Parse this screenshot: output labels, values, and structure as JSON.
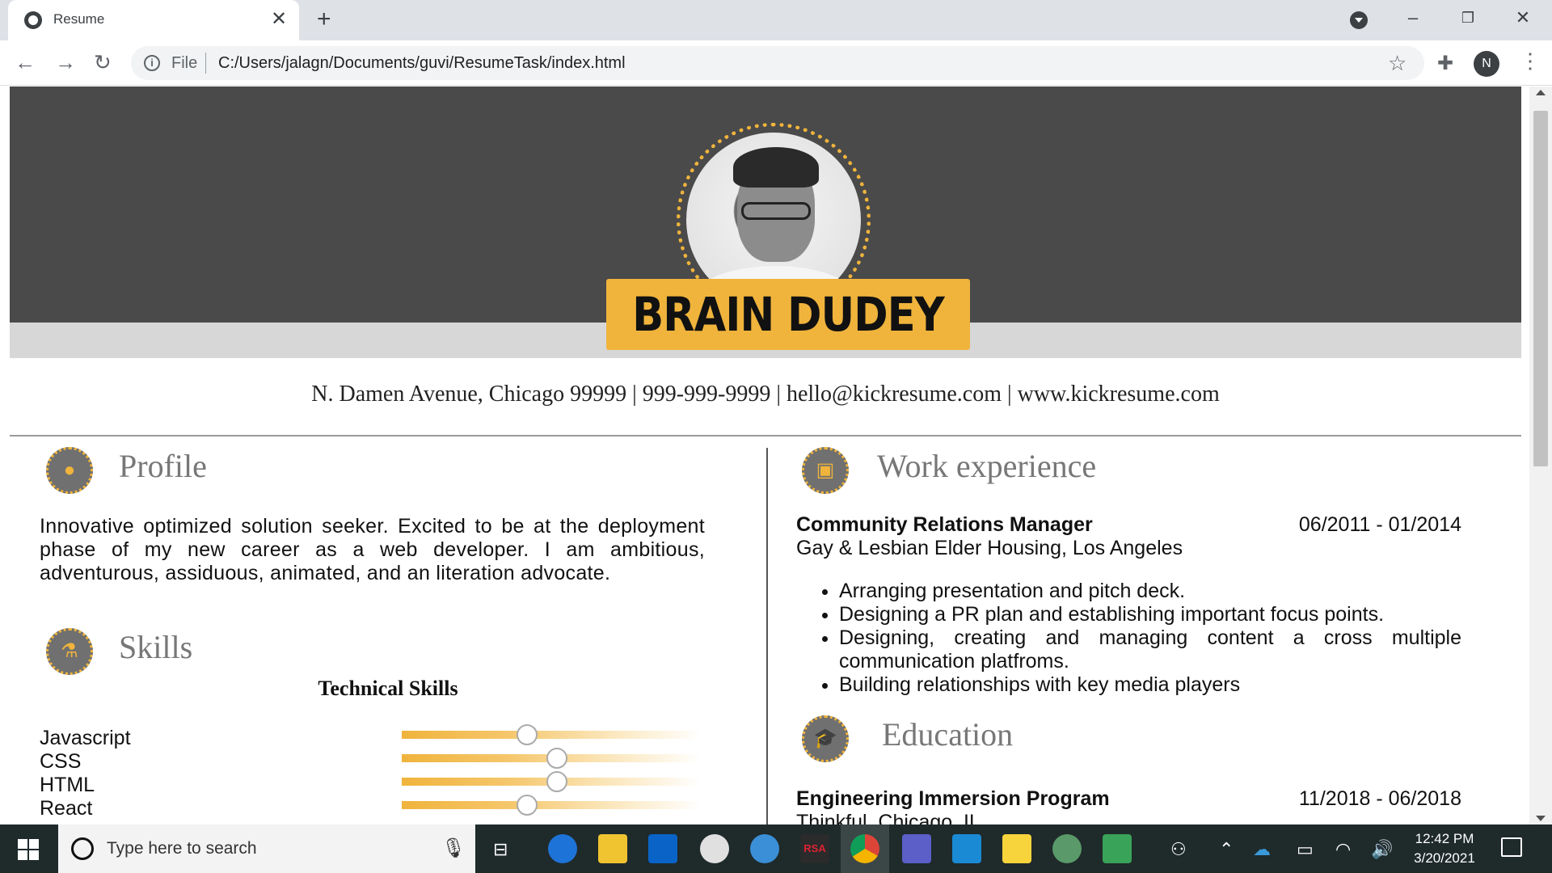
{
  "browser": {
    "tab_title": "Resume",
    "tab_close": "✕",
    "new_tab": "+",
    "omnibox_scheme": "File",
    "url": "C:/Users/jalagn/Documents/guvi/ResumeTask/index.html",
    "profile_initial": "N"
  },
  "resume": {
    "name": "BRAIN DUDEY",
    "contact": "N. Damen Avenue, Chicago 99999 | 999-999-9999 | hello@kickresume.com | www.kickresume.com",
    "accent_color": "#f0b43c",
    "header_color": "#4a4a4a",
    "profile": {
      "title": "Profile",
      "text": "Innovative optimized solution seeker. Excited to be at the deployment phase of my new career as a web developer. I am ambitious, adventurous, assiduous, animated, and an literation advocate."
    },
    "skills": {
      "title": "Skills",
      "subtitle": "Technical Skills",
      "items": [
        {
          "label": "Javascript",
          "level": 0.42
        },
        {
          "label": "CSS",
          "level": 0.52
        },
        {
          "label": "HTML",
          "level": 0.52
        },
        {
          "label": "React",
          "level": 0.42
        }
      ]
    },
    "work": {
      "title": "Work experience",
      "job_title": "Community Relations Manager",
      "job_dates": "06/2011 - 01/2014",
      "company": "Gay & Lesbian Elder Housing, Los Angeles",
      "bullets": [
        "Arranging presentation and pitch deck.",
        "Designing a PR plan and establishing important focus points.",
        "Designing, creating and managing content a cross multiple communication platfroms.",
        "Building relationships with key media players"
      ]
    },
    "education": {
      "title": "Education",
      "program": "Engineering Immersion Program",
      "dates": "11/2018 - 06/2018",
      "school": "Thinkful, Chicago, IL"
    }
  },
  "taskbar": {
    "search_placeholder": "Type here to search",
    "time": "12:42 PM",
    "date": "3/20/2021"
  }
}
